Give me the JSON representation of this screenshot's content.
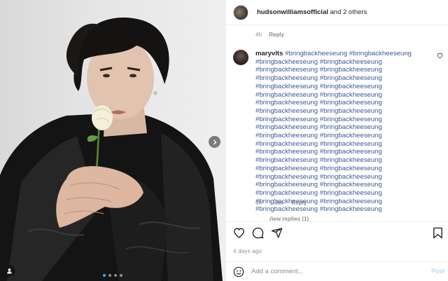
{
  "post": {
    "header_user": "hudsonwilliamsofficial",
    "header_rest": "and 2 others"
  },
  "previous_comment": {
    "time": "4h",
    "reply_label": "Reply"
  },
  "comment": {
    "username": "maryvlts",
    "hashtags": [
      "#bringbackheeseung",
      "#bringbackheeseung",
      "#bringbackheeseung",
      "#bringbackheeseung",
      "#bringbackheeseung",
      "#bringbackheeseung",
      "#bringbackheeseung",
      "#bringbackheeseung",
      "#bringbackheeseung",
      "#bringbackheeseung",
      "#bringbackheeseung",
      "#bringbackheeseung",
      "#bringbackheeseung",
      "#bringbackheeseung",
      "#bringbackheeseung",
      "#bringbackheeseung",
      "#bringbackheeseung",
      "#bringbackheeseung",
      "#bringbackheeseung",
      "#bringbackheeseung",
      "#bringbackheeseung",
      "#bringbackheeseung",
      "#bringbackheeseung",
      "#bringbackheeseung",
      "#bringbackheeseung",
      "#bringbackheeseung",
      "#bringbackheeseung",
      "#bringbackheeseung",
      "#bringbackheeseung",
      "#bringbackheeseung",
      "#bringbackheeseung",
      "#bringbackheeseung",
      "#bringbackheeseung",
      "#bringbackheeseung",
      "#bringbackheeseung",
      "#bringbackheeseung",
      "#bringbackheeseung",
      "#bringbackheeseung",
      "#bringbackheeseung",
      "#bringbackheeseung"
    ],
    "time": "4h",
    "likes": "1 like",
    "reply_label": "Reply",
    "view_replies": "View replies (1)"
  },
  "actions": {
    "icons": [
      "heart-icon",
      "comment-icon",
      "share-icon",
      "bookmark-icon"
    ],
    "timestamp": "4 days ago"
  },
  "add_comment": {
    "placeholder": "Add a comment...",
    "post_label": "Post"
  },
  "carousel": {
    "slides": 4,
    "active_index": 0
  },
  "colors": {
    "hashtag": "#3c5a9a",
    "meta_text": "#8e8e8e",
    "post_button": "#a5cef5",
    "active_dot": "#4aa3f5"
  }
}
